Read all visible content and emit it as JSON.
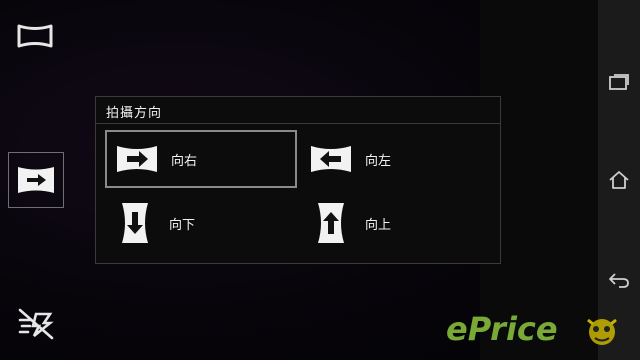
{
  "dialog": {
    "title": "拍攝方向",
    "options": [
      {
        "label": "向右",
        "icon": "arrow-right-icon",
        "selected": true
      },
      {
        "label": "向左",
        "icon": "arrow-left-icon",
        "selected": false
      },
      {
        "label": "向下",
        "icon": "arrow-down-icon",
        "selected": false
      },
      {
        "label": "向上",
        "icon": "arrow-up-icon",
        "selected": false
      }
    ]
  },
  "camera": {
    "mode_icon": "panorama-icon",
    "current_direction_icon": "arrow-right-icon",
    "flash_icon": "flash-off-icon"
  },
  "navbar": {
    "buttons": [
      "recent-apps-icon",
      "home-icon",
      "back-icon"
    ]
  },
  "watermark": {
    "text": "ePrice"
  },
  "colors": {
    "background": "#050308",
    "dialog_bg": "#0c0c0d",
    "navbar_bg": "#1b1b1c",
    "selected_border": "#8a8a8a",
    "watermark": "#8dc63f"
  }
}
